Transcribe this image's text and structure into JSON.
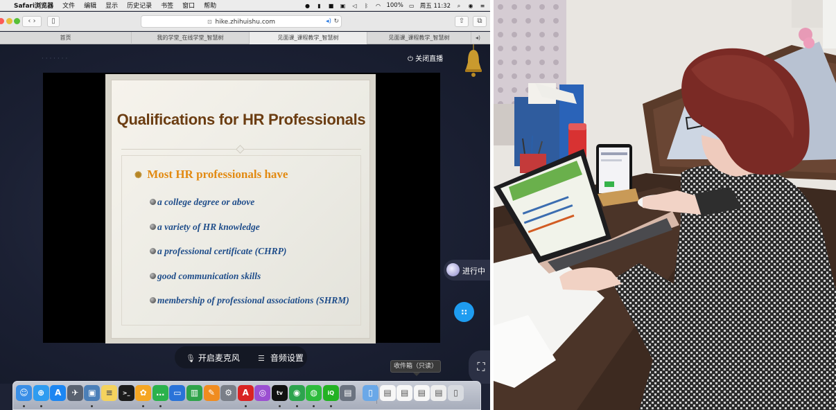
{
  "menubar": {
    "items": [
      "Safari浏览器",
      "文件",
      "编辑",
      "显示",
      "历史记录",
      "书签",
      "窗口",
      "帮助"
    ],
    "battery": "100%",
    "clock": "周五 11:32"
  },
  "browser": {
    "url": "hike.zhihuishu.com",
    "tabs": [
      "首页",
      "我的学堂_在线学堂_智慧树",
      "见面课_课程教学_智慧树",
      "见面课_课程教学_智慧树"
    ]
  },
  "live": {
    "close_live": "关闭直播",
    "running": "进行中",
    "mic_label": "开启麦克风",
    "audio_label": "音频设置",
    "tooltip": "收件箱（只读）"
  },
  "slide": {
    "title": "Qualifications for HR Professionals",
    "main_bullet": "Most HR professionals have",
    "items": [
      "a college degree or above",
      "a variety of HR knowledge",
      "a professional certificate (CHRP)",
      "good communication skills",
      "membership of professional associations (SHRM)"
    ]
  },
  "dock": {
    "icons": [
      "finder-icon",
      "safari-icon",
      "app-store-icon",
      "launchpad-icon",
      "preview-icon",
      "notes-icon",
      "terminal-icon",
      "photos-icon",
      "messages-icon",
      "keynote-icon",
      "numbers-icon",
      "pages-icon",
      "system-preferences-icon",
      "acrobat-icon",
      "podcasts-icon",
      "apple-tv-icon",
      "chrome-icon",
      "wechat-icon",
      "iqiyi-icon",
      "screenshot-icon",
      "folder-icon",
      "documents-icon",
      "downloads-icon",
      "desktop-icon",
      "file-icon",
      "trash-icon"
    ],
    "colors": {
      "finder": "#3a8ee6",
      "safari": "#2f9cf0",
      "app-store": "#1c86f2",
      "launchpad": "#5a6270",
      "preview": "#4b7fb8",
      "notes": "#f4d35e",
      "terminal": "#1c1c1c",
      "photos": "#f5a623",
      "messages": "#2bb24c",
      "keynote": "#2a73d8",
      "numbers": "#2fa34a",
      "pages": "#f08c20",
      "system-preferences": "#7a7f88",
      "acrobat": "#d92323",
      "podcasts": "#9b4fd1",
      "apple-tv": "#111111",
      "chrome": "#2da44e",
      "wechat": "#2dbb3c",
      "iqiyi": "#23b223",
      "screenshot": "#6b7380",
      "folder": "#6aa8e8",
      "documents": "#f7f7f7",
      "downloads": "#f7f7f7",
      "desktop": "#f7f7f7",
      "file": "#eeeeee",
      "trash": "#d8dbe0"
    }
  }
}
